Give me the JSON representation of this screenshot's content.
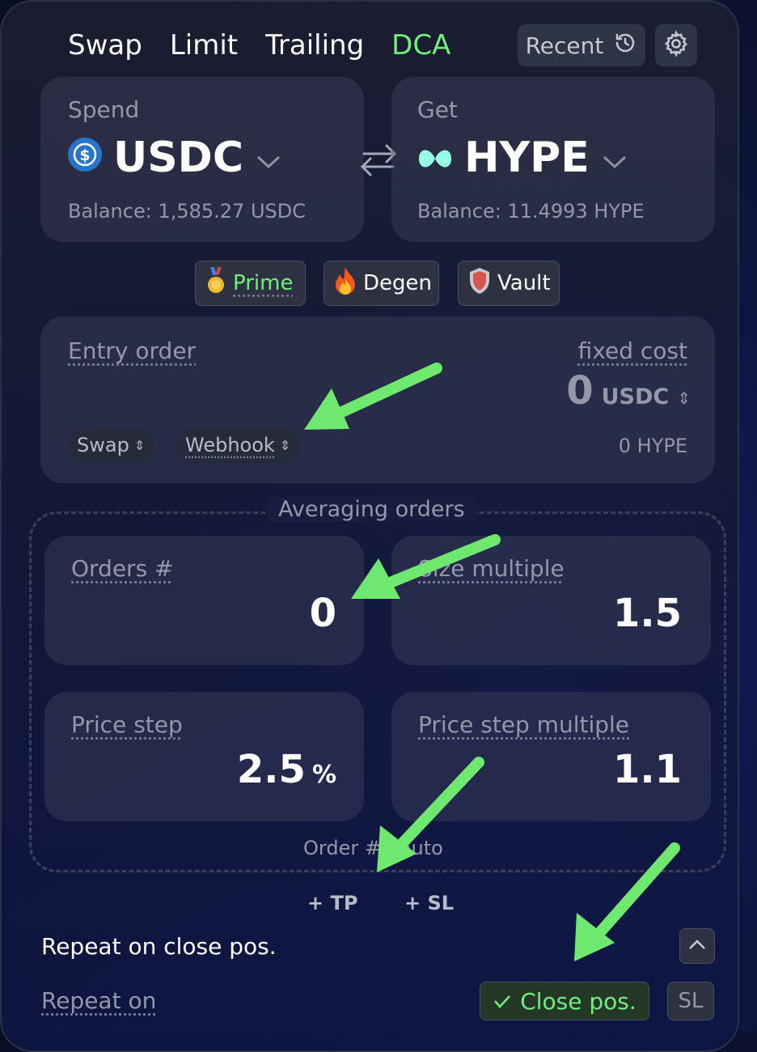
{
  "tabs": [
    "Swap",
    "Limit",
    "Trailing",
    "DCA"
  ],
  "active_tab": "DCA",
  "recent_label": "Recent",
  "spend": {
    "label": "Spend",
    "token": "USDC",
    "balance": "Balance: 1,585.27 USDC"
  },
  "get": {
    "label": "Get",
    "token": "HYPE",
    "balance": "Balance: 11.4993 HYPE"
  },
  "modes": [
    "Prime",
    "Degen",
    "Vault"
  ],
  "entry": {
    "title": "Entry order",
    "cost_label": "fixed cost",
    "amount": "0",
    "unit": "USDC",
    "type_chip": "Swap",
    "trigger_chip": "Webhook",
    "hype_amount": "0 HYPE"
  },
  "averaging": {
    "title": "Averaging orders",
    "orders_label": "Orders #",
    "orders_value": "0",
    "size_multiple_label": "Size multiple",
    "size_multiple_value": "1.5",
    "price_step_label": "Price step",
    "price_step_value": "2.5",
    "price_step_unit": "%",
    "price_step_multiple_label": "Price step multiple",
    "price_step_multiple_value": "1.1",
    "footer": "Order #1 auto"
  },
  "tp_label": "+ TP",
  "sl_label": "+ SL",
  "repeat": {
    "title": "Repeat on close pos.",
    "label": "Repeat on",
    "close_pos": "Close pos.",
    "sl": "SL"
  },
  "colors": {
    "accent": "#6ff07a",
    "usdc": "#2775ca",
    "hype": "#97fce4"
  }
}
